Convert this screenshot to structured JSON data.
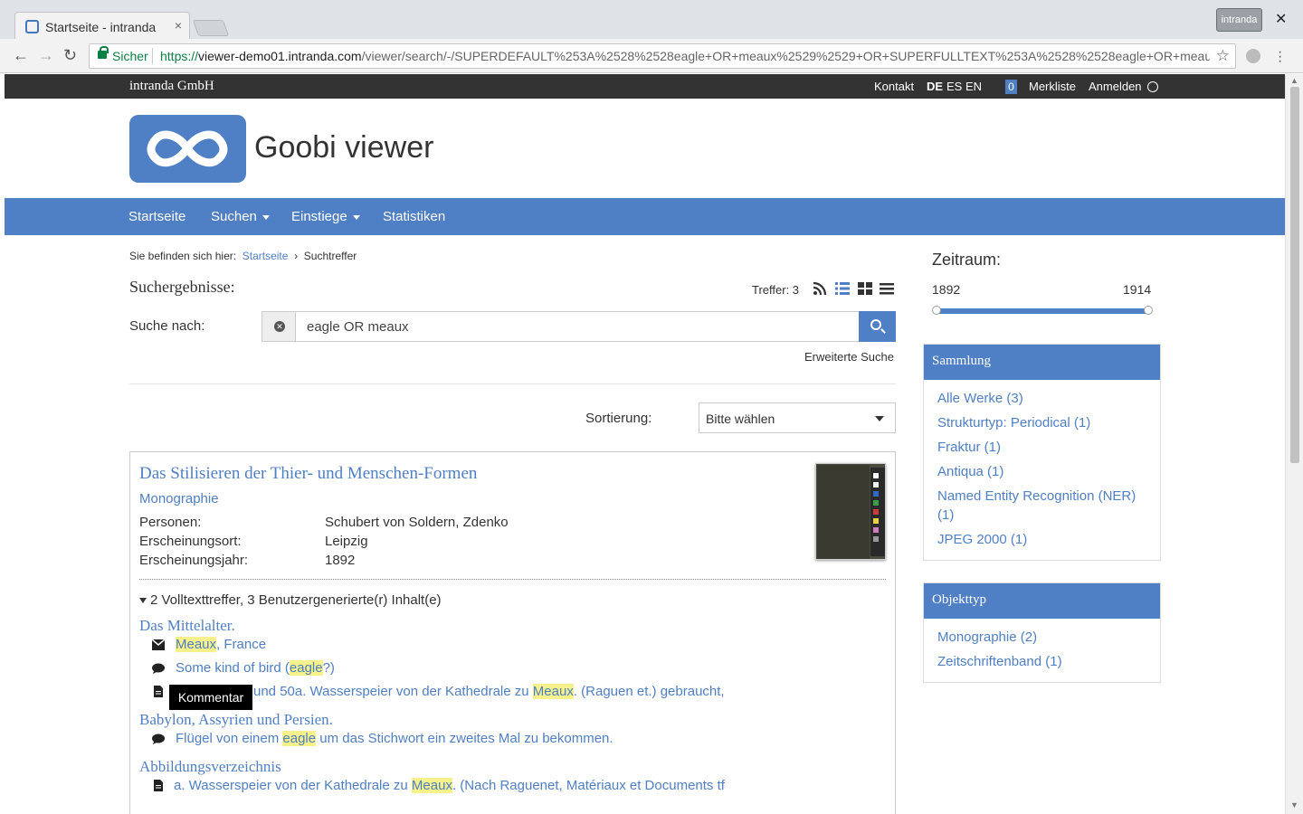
{
  "browser": {
    "tab_title": "Startseite - intranda",
    "tab_close": "×",
    "profile": "intranda",
    "window_close": "✕",
    "secure_label": "Sicher",
    "url_scheme": "https://",
    "url_host": "viewer-demo01.intranda.com",
    "url_path": "/viewer/search/-/SUPERDEFAULT%253A%2528%2528eagle+OR+meaux%2529%2529+OR+SUPERFULLTEXT%253A%2528%2528eagle+OR+meaux%...",
    "star": "☆",
    "back": "←",
    "forward": "→",
    "reload": "↻"
  },
  "topbar": {
    "brand": "intranda GmbH",
    "contact": "Kontakt",
    "lang_de": "DE",
    "lang_es": "ES",
    "lang_en": "EN",
    "bookmark_count": "0",
    "bookmarks": "Merkliste",
    "login": "Anmelden"
  },
  "header": {
    "title": "Goobi viewer"
  },
  "nav": {
    "home": "Startseite",
    "search": "Suchen",
    "entries": "Einstiege",
    "stats": "Statistiken"
  },
  "breadcrumb": {
    "prefix": "Sie befinden sich hier:",
    "home": "Startseite",
    "sep": "›",
    "current": "Suchtreffer"
  },
  "results": {
    "heading": "Suchergebnisse:",
    "hits": "Treffer: 3",
    "search_label": "Suche nach:",
    "query": "eagle OR meaux",
    "advanced": "Erweiterte Suche",
    "sort_label": "Sortierung:",
    "sort_value": "Bitte wählen"
  },
  "record": {
    "title": "Das Stilisieren der Thier- und Menschen-Formen",
    "type": "Monographie",
    "meta": [
      {
        "label": "Personen:",
        "value": "Schubert von Soldern, Zdenko"
      },
      {
        "label": "Erscheinungsort:",
        "value": "Leipzig"
      },
      {
        "label": "Erscheinungsjahr:",
        "value": "1892"
      }
    ],
    "fulltext_toggle": "2 Volltexttreffer, 3 Benutzergenerierte(r) Inhalt(e)",
    "sections": [
      {
        "title": "Das Mittelalter."
      },
      {
        "title": "Babylon, Assyrien und Persien."
      },
      {
        "title": "Abbildungsverzeichnis"
      }
    ],
    "hits": {
      "h1": {
        "icon": "envelope-icon",
        "hl": "Meaux",
        "post": ", France"
      },
      "h2": {
        "icon": "comment-icon",
        "pre": "Some kind of bird (",
        "hl": "eagle",
        "post": "?)"
      },
      "h3": {
        "icon": "document-icon",
        "pre": "und 50a. Wasserspeier von der Kathedrale zu ",
        "hl": "Meaux",
        "post": ". (Raguen et.) gebraucht,"
      },
      "h4": {
        "icon": "comment-icon",
        "pre": "Flügel von einem ",
        "hl": "eagle",
        "post": " um das Stichwort ein zweites Mal zu bekommen."
      },
      "h5": {
        "icon": "document-icon",
        "pre": "a. Wasserspeier von der Kathedrale zu ",
        "hl": "Meaux",
        "post": ". (Nach Raguenet, Matériaux et Documents tf"
      }
    },
    "tooltip": "Kommentar"
  },
  "sidebar": {
    "timespan_title": "Zeitraum:",
    "year_from": "1892",
    "year_to": "1914",
    "collection_title": "Sammlung",
    "collection_items": [
      "Alle Werke (3)",
      "Strukturtyp: Periodical (1)",
      "Fraktur (1)",
      "Antiqua (1)",
      "Named Entity Recognition (NER) (1)",
      "JPEG 2000 (1)"
    ],
    "objecttype_title": "Objekttyp",
    "objecttype_items": [
      "Monographie (2)",
      "Zeitschriftenband (1)"
    ]
  },
  "colors": {
    "accent": "#4f7fc4",
    "topbar": "#333333",
    "highlight": "#f6f18a"
  }
}
